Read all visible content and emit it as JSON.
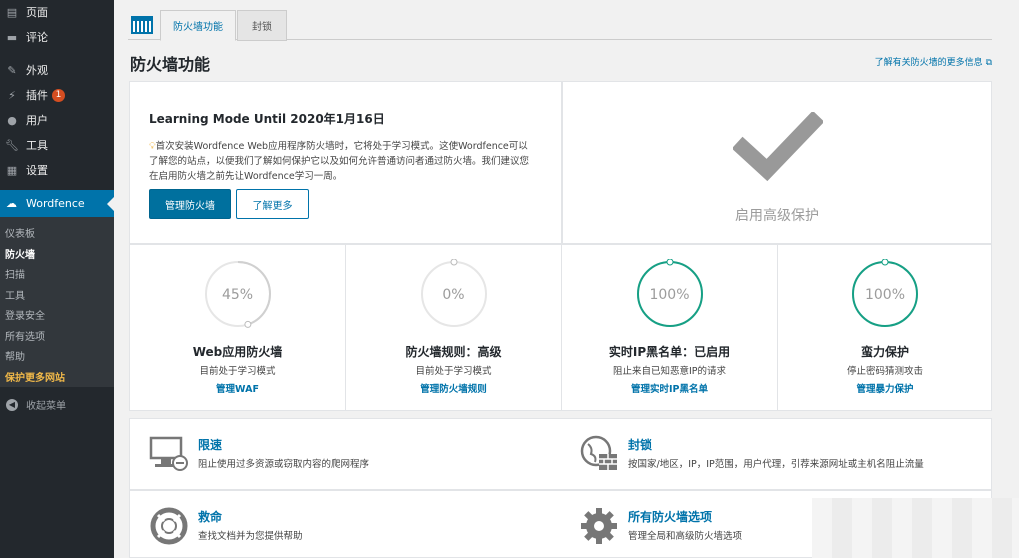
{
  "sidebar": {
    "items": [
      {
        "label": "页面",
        "icon": "pages-icon"
      },
      {
        "label": "评论",
        "icon": "comments-icon"
      },
      {
        "label": "外观",
        "icon": "appearance-icon"
      },
      {
        "label": "插件",
        "icon": "plugins-icon",
        "badge": "1"
      },
      {
        "label": "用户",
        "icon": "users-icon"
      },
      {
        "label": "工具",
        "icon": "tools-icon"
      },
      {
        "label": "设置",
        "icon": "settings-icon"
      }
    ],
    "wordfence": {
      "label": "Wordfence",
      "icon": "wordfence-icon"
    },
    "submenu": [
      "仪表板",
      "防火墙",
      "扫描",
      "工具",
      "登录安全",
      "所有选项",
      "帮助",
      "保护更多网站"
    ],
    "collapse": "收起菜单"
  },
  "tabs": [
    {
      "label": "防火墙功能",
      "active": true
    },
    {
      "label": "封锁",
      "active": false
    }
  ],
  "page": {
    "title": "防火墙功能",
    "learn_more": "了解有关防火墙的更多信息"
  },
  "learning": {
    "title": "Learning Mode Until 2020年1月16日",
    "text": "首次安装Wordfence Web应用程序防火墙时，它将处于学习模式。这使Wordfence可以了解您的站点，以便我们了解如何保护它以及如何允许普通访问者通过防火墙。我们建议您在启用防火墙之前先让Wordfence学习一周。",
    "manage_button": "管理防火墙",
    "learn_button": "了解更多"
  },
  "advanced": {
    "label": "启用高级保护"
  },
  "stats": [
    {
      "percent": "45%",
      "value": 45,
      "title": "Web应用防火墙",
      "subtitle": "目前处于学习模式",
      "link": "管理WAF"
    },
    {
      "percent": "0%",
      "value": 0,
      "title": "防火墙规则：高级",
      "subtitle": "目前处于学习模式",
      "link": "管理防火墙规则"
    },
    {
      "percent": "100%",
      "value": 100,
      "title": "实时IP黑名单：已启用",
      "subtitle": "阻止来自已知恶意IP的请求",
      "link": "管理实时IP黑名单"
    },
    {
      "percent": "100%",
      "value": 100,
      "title": "蛮力保护",
      "subtitle": "停止密码猜测攻击",
      "link": "管理暴力保护"
    }
  ],
  "features": [
    {
      "title": "限速",
      "desc": "阻止使用过多资源或窃取内容的爬网程序",
      "icon": "rate-limiting-icon"
    },
    {
      "title": "封锁",
      "desc": "按国家/地区，IP，IP范围，用户代理，引荐来源网址或主机名阻止流量",
      "icon": "blocking-icon"
    },
    {
      "title": "救命",
      "desc": "查找文档并为您提供帮助",
      "icon": "help-lifebuoy-icon"
    },
    {
      "title": "所有防火墙选项",
      "desc": "管理全局和高级防火墙选项",
      "icon": "gear-icon"
    }
  ],
  "colors": {
    "accent": "#0073aa",
    "teal": "#16a085",
    "grey": "#d8d8d8",
    "sidebar": "#23282d"
  }
}
